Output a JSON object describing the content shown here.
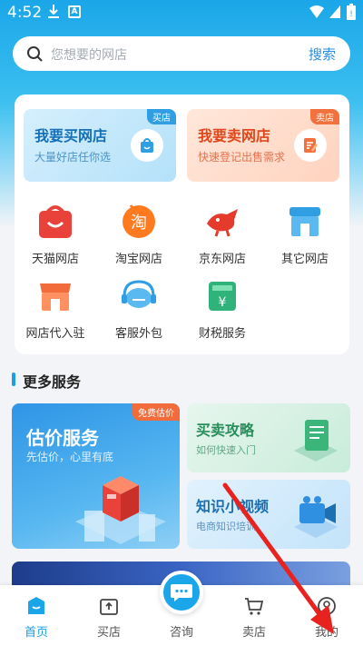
{
  "status_bar": {
    "time": "4:52",
    "a_badge": "A"
  },
  "search": {
    "placeholder": "您想要的网店",
    "button": "搜索"
  },
  "buy_card": {
    "title": "我要买网店",
    "subtitle": "大量好店任你选",
    "tag": "买店"
  },
  "sell_card": {
    "title": "我要卖网店",
    "subtitle": "快速登记出售需求",
    "tag": "卖店"
  },
  "grid": [
    {
      "label": "天猫网店",
      "icon": "tmall-icon"
    },
    {
      "label": "淘宝网店",
      "icon": "taobao-icon"
    },
    {
      "label": "京东网店",
      "icon": "jd-icon"
    },
    {
      "label": "其它网店",
      "icon": "other-shop-icon"
    },
    {
      "label": "网店代入驻",
      "icon": "store-settle-icon"
    },
    {
      "label": "客服外包",
      "icon": "headset-icon"
    },
    {
      "label": "财税服务",
      "icon": "tax-icon"
    }
  ],
  "more_services": {
    "title": "更多服务",
    "valuation": {
      "title": "估价服务",
      "subtitle": "先估价，心里有底",
      "tag": "免费估价"
    },
    "strategy": {
      "title": "买卖攻略",
      "subtitle": "如何快速入门"
    },
    "video": {
      "title": "知识小视频",
      "subtitle": "电商知识培训"
    }
  },
  "tabs": [
    {
      "label": "首页",
      "icon": "home-icon",
      "active": true
    },
    {
      "label": "买店",
      "icon": "buy-shop-icon"
    },
    {
      "label": "咨询",
      "icon": "chat-icon"
    },
    {
      "label": "卖店",
      "icon": "cart-icon"
    },
    {
      "label": "我的",
      "icon": "profile-icon"
    }
  ],
  "colors": {
    "primary": "#1aa6e8",
    "sell_accent": "#e1471b",
    "annotation_arrow": "#e8231f"
  }
}
